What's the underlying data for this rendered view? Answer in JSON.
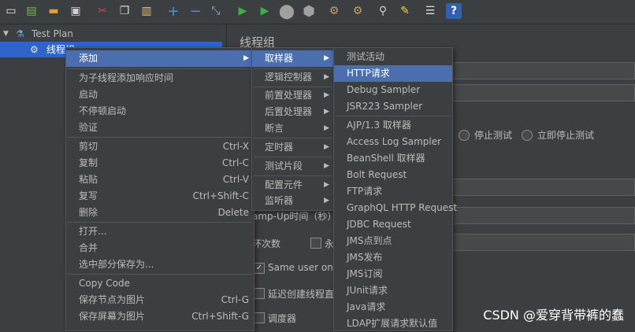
{
  "toolbar": {
    "icons": [
      "new-icon",
      "templates-icon",
      "open-icon",
      "save-icon",
      "cut-icon",
      "copy-icon",
      "paste-icon",
      "expand-icon",
      "collapse-icon",
      "toggle-icon",
      "start-icon",
      "start-no-pause-icon",
      "stop-icon",
      "shutdown-icon",
      "clear-icon",
      "clear-all-icon",
      "search-icon",
      "reset-search-icon",
      "function-helper-icon",
      "help-icon"
    ]
  },
  "tree": {
    "test_plan": "Test Plan",
    "thread_group": "线程组"
  },
  "panel": {
    "title": "线程组",
    "stop_test": "停止测试",
    "stop_test_now": "立即停止测试",
    "rampup_label": "amp-Up时间（秒）",
    "loop_label": "环次数",
    "forever_label": "永",
    "same_user_label": "Same user on ea",
    "delay_label": "延迟创建线程直",
    "scheduler_label": "调度器"
  },
  "context_menu": {
    "items": [
      {
        "label": "添加",
        "shortcut": "",
        "submenu": true,
        "selected": true
      },
      {
        "label": "为子线程添加响应时间",
        "shortcut": ""
      },
      {
        "label": "启动",
        "shortcut": ""
      },
      {
        "label": "不停顿启动",
        "shortcut": ""
      },
      {
        "label": "验证",
        "shortcut": ""
      },
      {
        "label": "剪切",
        "shortcut": "Ctrl-X"
      },
      {
        "label": "复制",
        "shortcut": "Ctrl-C"
      },
      {
        "label": "粘贴",
        "shortcut": "Ctrl-V"
      },
      {
        "label": "复写",
        "shortcut": "Ctrl+Shift-C"
      },
      {
        "label": "删除",
        "shortcut": "Delete"
      },
      {
        "label": "打开...",
        "shortcut": ""
      },
      {
        "label": "合并",
        "shortcut": ""
      },
      {
        "label": "选中部分保存为...",
        "shortcut": ""
      },
      {
        "label": "Copy Code",
        "shortcut": ""
      },
      {
        "label": "保存节点为图片",
        "shortcut": "Ctrl-G"
      },
      {
        "label": "保存屏幕为图片",
        "shortcut": "Ctrl+Shift-G"
      }
    ]
  },
  "add_menu": {
    "items": [
      {
        "label": "取样器",
        "selected": true
      },
      {
        "label": "逻辑控制器"
      },
      {
        "label": "前置处理器"
      },
      {
        "label": "后置处理器"
      },
      {
        "label": "断言"
      },
      {
        "label": "定时器"
      },
      {
        "label": "测试片段"
      },
      {
        "label": "配置元件"
      },
      {
        "label": "监听器"
      }
    ]
  },
  "sampler_menu": {
    "items": [
      {
        "label": "测试活动"
      },
      {
        "label": "HTTP请求",
        "selected": true
      },
      {
        "label": "Debug Sampler"
      },
      {
        "label": "JSR223 Sampler"
      },
      {
        "label": "AJP/1.3 取样器"
      },
      {
        "label": "Access Log Sampler"
      },
      {
        "label": "BeanShell 取样器"
      },
      {
        "label": "Bolt Request"
      },
      {
        "label": "FTP请求"
      },
      {
        "label": "GraphQL HTTP Request"
      },
      {
        "label": "JDBC Request"
      },
      {
        "label": "JMS点到点"
      },
      {
        "label": "JMS发布"
      },
      {
        "label": "JMS订阅"
      },
      {
        "label": "JUnit请求"
      },
      {
        "label": "Java请求"
      },
      {
        "label": "LDAP扩展请求默认值"
      }
    ]
  },
  "watermark": "CSDN @爱穿背带裤的蠢"
}
